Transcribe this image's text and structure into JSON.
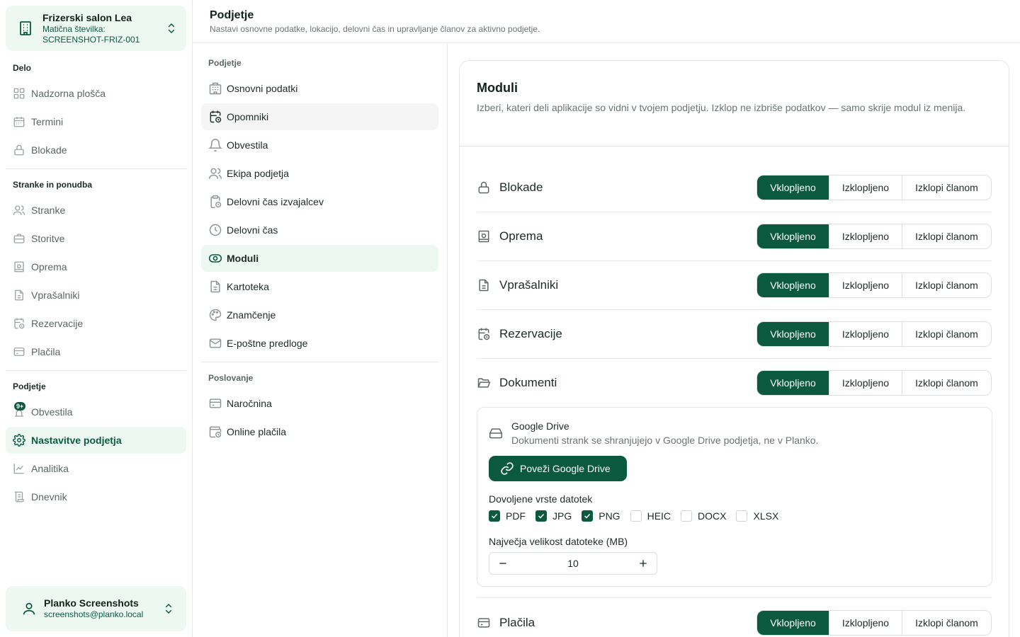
{
  "org": {
    "name": "Frizerski salon Lea",
    "sub_line1": "Matična številka:",
    "sub_line2": "SCREENSHOT-FRIZ-001"
  },
  "sidebar": {
    "sections": [
      {
        "title": "Delo",
        "items": [
          {
            "label": "Nadzorna plošča",
            "icon": "dashboard-icon"
          },
          {
            "label": "Termini",
            "icon": "calendar-icon"
          },
          {
            "label": "Blokade",
            "icon": "lock-icon"
          }
        ]
      },
      {
        "title": "Stranke in ponudba",
        "items": [
          {
            "label": "Stranke",
            "icon": "users-icon"
          },
          {
            "label": "Storitve",
            "icon": "briefcase-icon"
          },
          {
            "label": "Oprema",
            "icon": "equipment-icon"
          },
          {
            "label": "Vprašalniki",
            "icon": "form-icon"
          },
          {
            "label": "Rezervacije",
            "icon": "calendar-clock-icon"
          },
          {
            "label": "Plačila",
            "icon": "credit-card-icon"
          }
        ]
      },
      {
        "title": "Podjetje",
        "items": [
          {
            "label": "Obvestila",
            "icon": "announcement-icon",
            "badge": "9+"
          },
          {
            "label": "Nastavitve podjetja",
            "icon": "gear-icon",
            "active": true
          },
          {
            "label": "Analitika",
            "icon": "chart-line-icon"
          },
          {
            "label": "Dnevnik",
            "icon": "scroll-icon"
          }
        ]
      }
    ]
  },
  "user": {
    "name": "Planko Screenshots",
    "email": "screenshots@planko.local"
  },
  "header": {
    "title": "Podjetje",
    "subtitle": "Nastavi osnovne podatke, lokacijo, delovni čas in upravljanje članov za aktivno podjetje."
  },
  "settings_menu": {
    "section1": "Podjetje",
    "items1": [
      {
        "label": "Osnovni podatki",
        "icon": "building-icon"
      },
      {
        "label": "Opomniki",
        "icon": "calendar-clock-icon",
        "hover": true
      },
      {
        "label": "Obvestila",
        "icon": "bell-icon"
      },
      {
        "label": "Ekipa podjetja",
        "icon": "users-icon"
      },
      {
        "label": "Delovni čas izvajalcev",
        "icon": "clipboard-clock-icon"
      },
      {
        "label": "Delovni čas",
        "icon": "clock-icon"
      },
      {
        "label": "Moduli",
        "icon": "toggle-icon",
        "active": true
      },
      {
        "label": "Kartoteka",
        "icon": "file-icon"
      },
      {
        "label": "Znamčenje",
        "icon": "palette-icon"
      },
      {
        "label": "E-poštne predloge",
        "icon": "mail-icon"
      }
    ],
    "section2": "Poslovanje",
    "items2": [
      {
        "label": "Naročnina",
        "icon": "credit-card-icon"
      },
      {
        "label": "Online plačila",
        "icon": "wallet-icon"
      }
    ]
  },
  "modules_card": {
    "title": "Moduli",
    "description": "Izberi, kateri deli aplikacije so vidni v tvojem podjetju. Izklop ne izbriše podatkov — samo skrije modul iz menija.",
    "options": [
      "Vklopljeno",
      "Izklopljeno",
      "Izklopi članom"
    ],
    "modules": [
      {
        "name": "Blokade",
        "icon": "lock-icon",
        "selected": "Vklopljeno"
      },
      {
        "name": "Oprema",
        "icon": "equipment-icon",
        "selected": "Vklopljeno"
      },
      {
        "name": "Vprašalniki",
        "icon": "form-icon",
        "selected": "Vklopljeno"
      },
      {
        "name": "Rezervacije",
        "icon": "calendar-clock-icon",
        "selected": "Vklopljeno"
      },
      {
        "name": "Dokumenti",
        "icon": "folder-open-icon",
        "selected": "Vklopljeno"
      },
      {
        "name": "Plačila",
        "icon": "credit-card-icon",
        "selected": "Vklopljeno"
      }
    ],
    "drive": {
      "title": "Google Drive",
      "description": "Dokumenti strank se shranjujejo v Google Drive podjetja, ne v Planko.",
      "connect_label": "Poveži Google Drive",
      "types_label": "Dovoljene vrste datotek",
      "file_types": [
        {
          "label": "PDF",
          "checked": true
        },
        {
          "label": "JPG",
          "checked": true
        },
        {
          "label": "PNG",
          "checked": true
        },
        {
          "label": "HEIC",
          "checked": false
        },
        {
          "label": "DOCX",
          "checked": false
        },
        {
          "label": "XLSX",
          "checked": false
        }
      ],
      "max_size_label": "Največja velikost datoteke (MB)",
      "max_size_value": "10"
    }
  },
  "colors": {
    "brand": "#0b5a3f",
    "active_bg": "#ecf8f1",
    "border": "#e3e6e4"
  }
}
